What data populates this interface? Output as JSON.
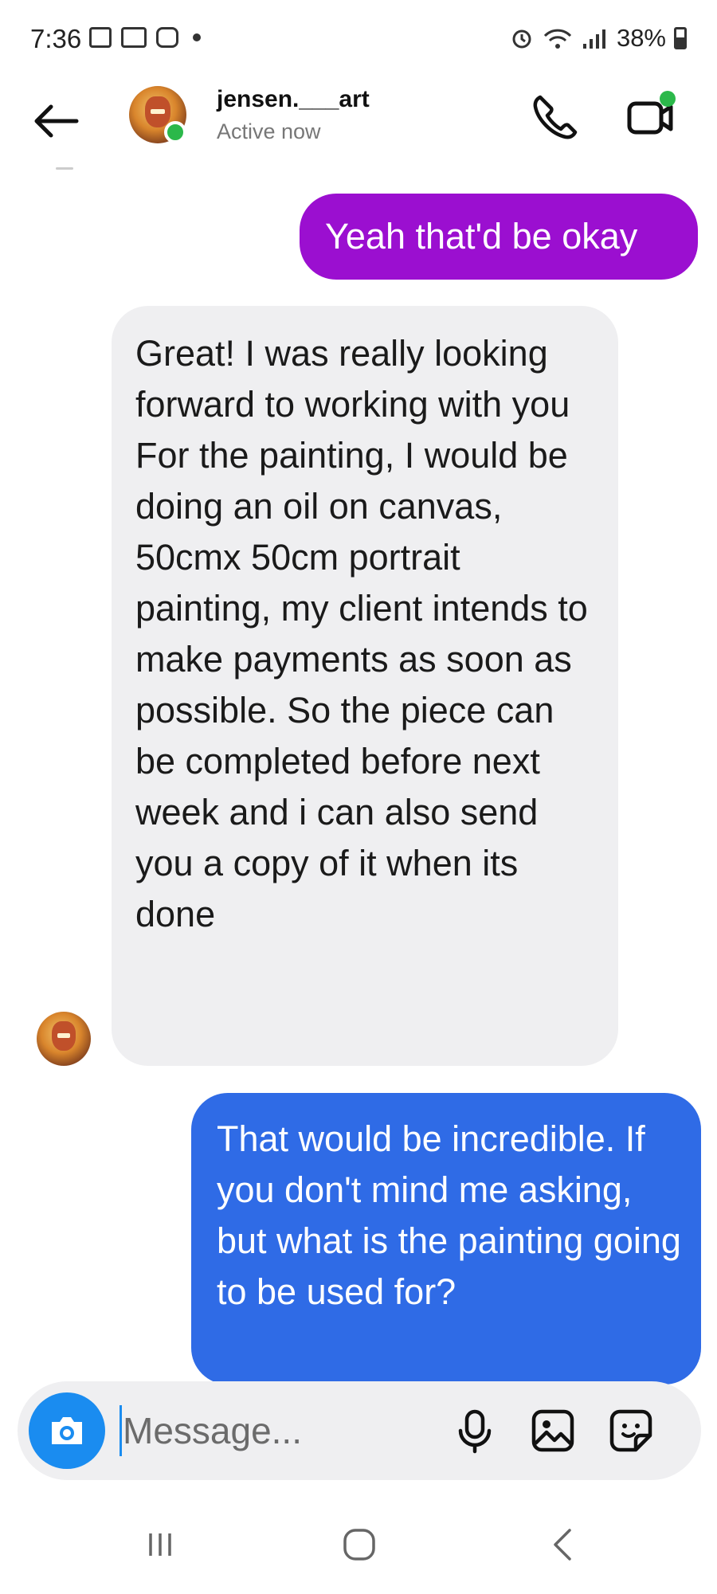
{
  "status_bar": {
    "time": "7:36",
    "battery": "38%",
    "left_icons": [
      "gallery-icon",
      "voicemail-icon",
      "instagram-icon",
      "notification-dot"
    ],
    "right_icons": [
      "alarm-icon",
      "wifi-icon",
      "signal-icon",
      "battery-icon"
    ]
  },
  "header": {
    "name": "jensen.___art",
    "status": "Active now",
    "online_color": "#2bb84a"
  },
  "messages": [
    {
      "sender": "me",
      "text": "Yeah that'd be okay",
      "color": "#9b0fd0"
    },
    {
      "sender": "them",
      "text": "Great! I was really looking forward to working with you For the painting, I would be doing an oil on canvas, 50cmx 50cm portrait painting, my client intends to make payments as soon as possible. So the piece can be completed before next week and i can also send you a copy of it when its done",
      "color": "#efeff1"
    },
    {
      "sender": "me",
      "text": "That would be incredible. If you don't mind me asking, but what is the painting going to be used for?",
      "color": "#2f6be6"
    }
  ],
  "composer": {
    "placeholder": "Message...",
    "accent": "#1a8cf0"
  }
}
